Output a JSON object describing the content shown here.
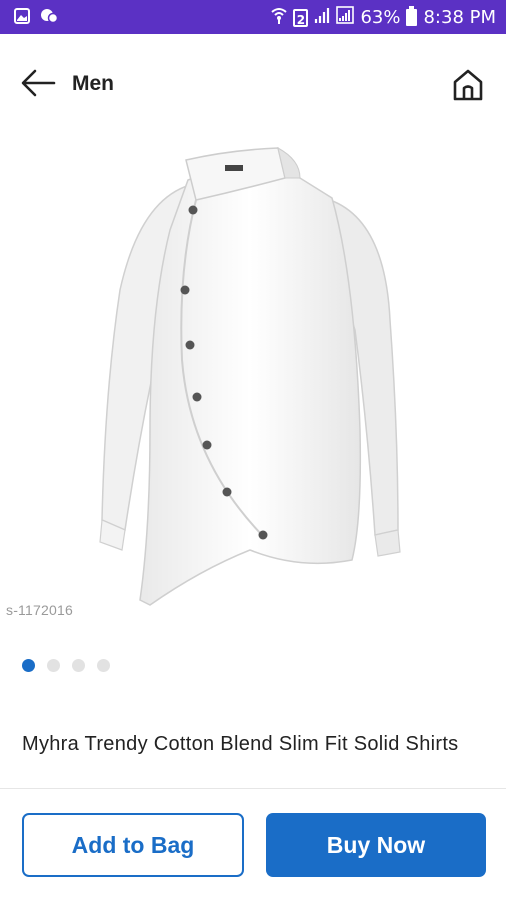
{
  "status_bar": {
    "battery": "63%",
    "time": "8:38 PM",
    "sim": "2",
    "left_icons": [
      "gallery-icon",
      "chat-icon"
    ],
    "right_icons": [
      "wifi-icon",
      "sim-2-icon",
      "signal-icon",
      "signal-r-icon",
      "battery-icon"
    ]
  },
  "header": {
    "title": "Men",
    "back_icon": "arrow-left-icon",
    "home_icon": "home-icon"
  },
  "product": {
    "sku": "s-1172016",
    "title": "Myhra Trendy Cotton Blend Slim Fit Solid Shirts",
    "image_count": 4,
    "active_image": 0
  },
  "actions": {
    "add_to_bag": "Add to Bag",
    "buy_now": "Buy Now"
  },
  "colors": {
    "status_bar": "#5b31c4",
    "accent": "#1a6dc7"
  }
}
